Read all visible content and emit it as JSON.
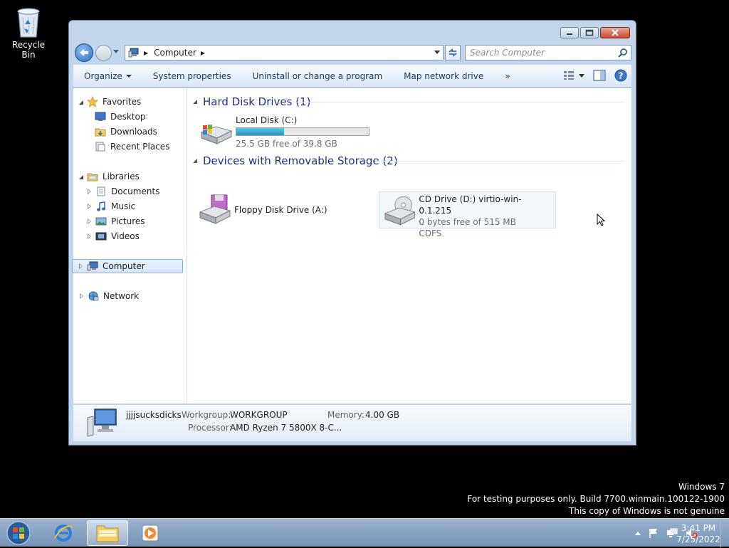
{
  "desktop": {
    "recycle_bin_label": "Recycle Bin",
    "watermark": [
      "Windows 7",
      "For testing purposes only. Build 7700.winmain.100122-1900",
      "This copy of Windows is not genuine"
    ]
  },
  "window": {
    "address": {
      "crumb": "Computer"
    },
    "search": {
      "placeholder": "Search Computer"
    },
    "toolbar": {
      "organize": "Organize",
      "system_properties": "System properties",
      "uninstall": "Uninstall or change a program",
      "map_drive": "Map network drive",
      "more": "»"
    },
    "nav": {
      "favorites": "Favorites",
      "desktop": "Desktop",
      "downloads": "Downloads",
      "recent": "Recent Places",
      "libraries": "Libraries",
      "documents": "Documents",
      "music": "Music",
      "pictures": "Pictures",
      "videos": "Videos",
      "computer": "Computer",
      "network": "Network"
    },
    "content": {
      "hdd_header": "Hard Disk Drives (1)",
      "removable_header": "Devices with Removable Storage (2)",
      "local_disk": {
        "name": "Local Disk (C:)",
        "free": "25.5 GB free of 39.8 GB",
        "used_fraction": 0.36
      },
      "floppy": {
        "name": "Floppy Disk Drive (A:)"
      },
      "cd": {
        "name": "CD Drive (D:) virtio-win-0.1.215",
        "free": "0 bytes free of 515 MB",
        "fs": "CDFS"
      }
    },
    "details": {
      "computer_name": "jjjjsucksdicks",
      "workgroup_label": "Workgroup:",
      "workgroup": "WORKGROUP",
      "memory_label": "Memory:",
      "memory": "4.00 GB",
      "processor_label": "Processor:",
      "processor": "AMD Ryzen 7 5800X 8-C..."
    }
  },
  "taskbar": {
    "time": "3:41 PM",
    "date": "7/25/2022"
  }
}
